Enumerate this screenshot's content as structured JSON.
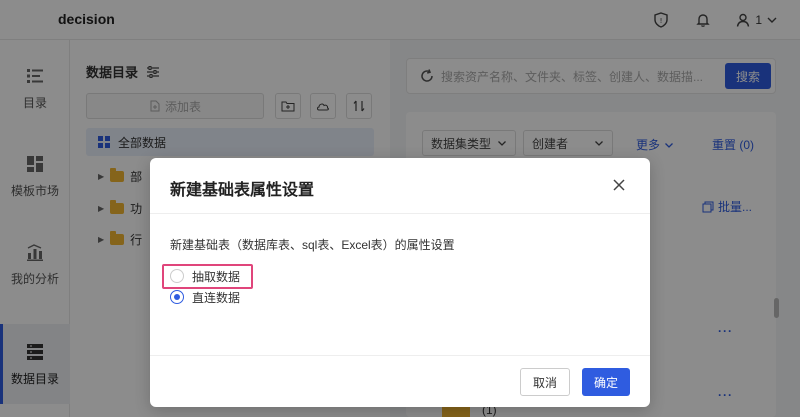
{
  "app": {
    "title": "decision"
  },
  "header": {
    "user_label": "1"
  },
  "nav": {
    "items": [
      {
        "label": "目录"
      },
      {
        "label": "模板市场"
      },
      {
        "label": "我的分析"
      },
      {
        "label": "数据目录"
      }
    ]
  },
  "catalog": {
    "title": "数据目录",
    "add_table_label": "添加表",
    "all_data_label": "全部数据",
    "folders": [
      {
        "label": "部"
      },
      {
        "label": "功"
      },
      {
        "label": "行"
      }
    ]
  },
  "main": {
    "search_placeholder": "搜索资产名称、文件夹、标签、创建人、数据描...",
    "search_button": "搜索",
    "filter_type": "数据集类型",
    "filter_creator": "创建者",
    "more_label": "更多",
    "reset_label": "重置 (0)",
    "batch_label": "批量...",
    "count_label": "(1)",
    "ellipsis": "···"
  },
  "dialog": {
    "title": "新建基础表属性设置",
    "description": "新建基础表（数据库表、sql表、Excel表）的属性设置",
    "options": [
      {
        "label": "抽取数据",
        "checked": false
      },
      {
        "label": "直连数据",
        "checked": true
      }
    ],
    "cancel_label": "取消",
    "ok_label": "确定"
  },
  "colors": {
    "accent": "#2f5ce0",
    "highlight": "#e0457b",
    "folder": "#f2b632"
  }
}
